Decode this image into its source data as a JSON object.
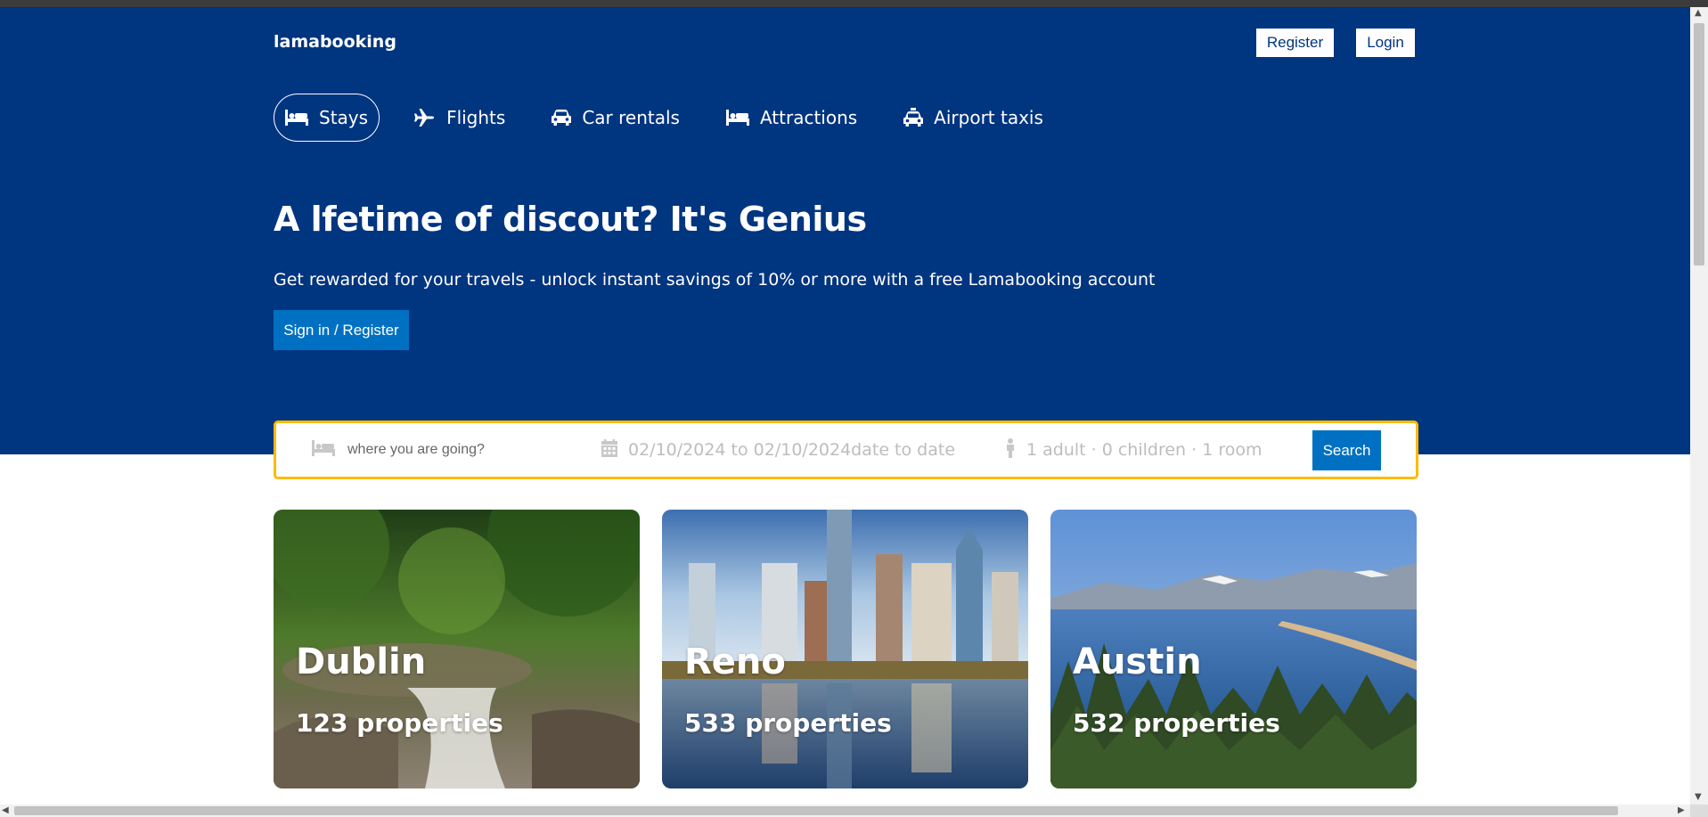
{
  "header": {
    "brand": "lamabooking",
    "register_label": "Register",
    "login_label": "Login"
  },
  "tabs": [
    {
      "label": "Stays",
      "icon": "bed-icon",
      "active": true
    },
    {
      "label": "Flights",
      "icon": "plane-icon",
      "active": false
    },
    {
      "label": "Car rentals",
      "icon": "car-icon",
      "active": false
    },
    {
      "label": "Attractions",
      "icon": "bed-icon",
      "active": false
    },
    {
      "label": "Airport taxis",
      "icon": "taxi-icon",
      "active": false
    }
  ],
  "hero": {
    "title": "A lfetime of discout? It's Genius",
    "subtitle": "Get rewarded for your travels - unlock instant savings of 10% or more with a free Lamabooking account",
    "cta_label": "Sign in / Register"
  },
  "search": {
    "destination_placeholder": "where you are going?",
    "date_text": "02/10/2024 to 02/10/2024date to date",
    "occupancy_text": "1 adult · 0 children · 1 room",
    "button_label": "Search"
  },
  "featured": [
    {
      "city": "Dublin",
      "properties": "123 properties"
    },
    {
      "city": "Reno",
      "properties": "533 properties"
    },
    {
      "city": "Austin",
      "properties": "532 properties"
    }
  ],
  "colors": {
    "hero_bg": "#003580",
    "accent_blue": "#0071c2",
    "search_border": "#febb02"
  }
}
